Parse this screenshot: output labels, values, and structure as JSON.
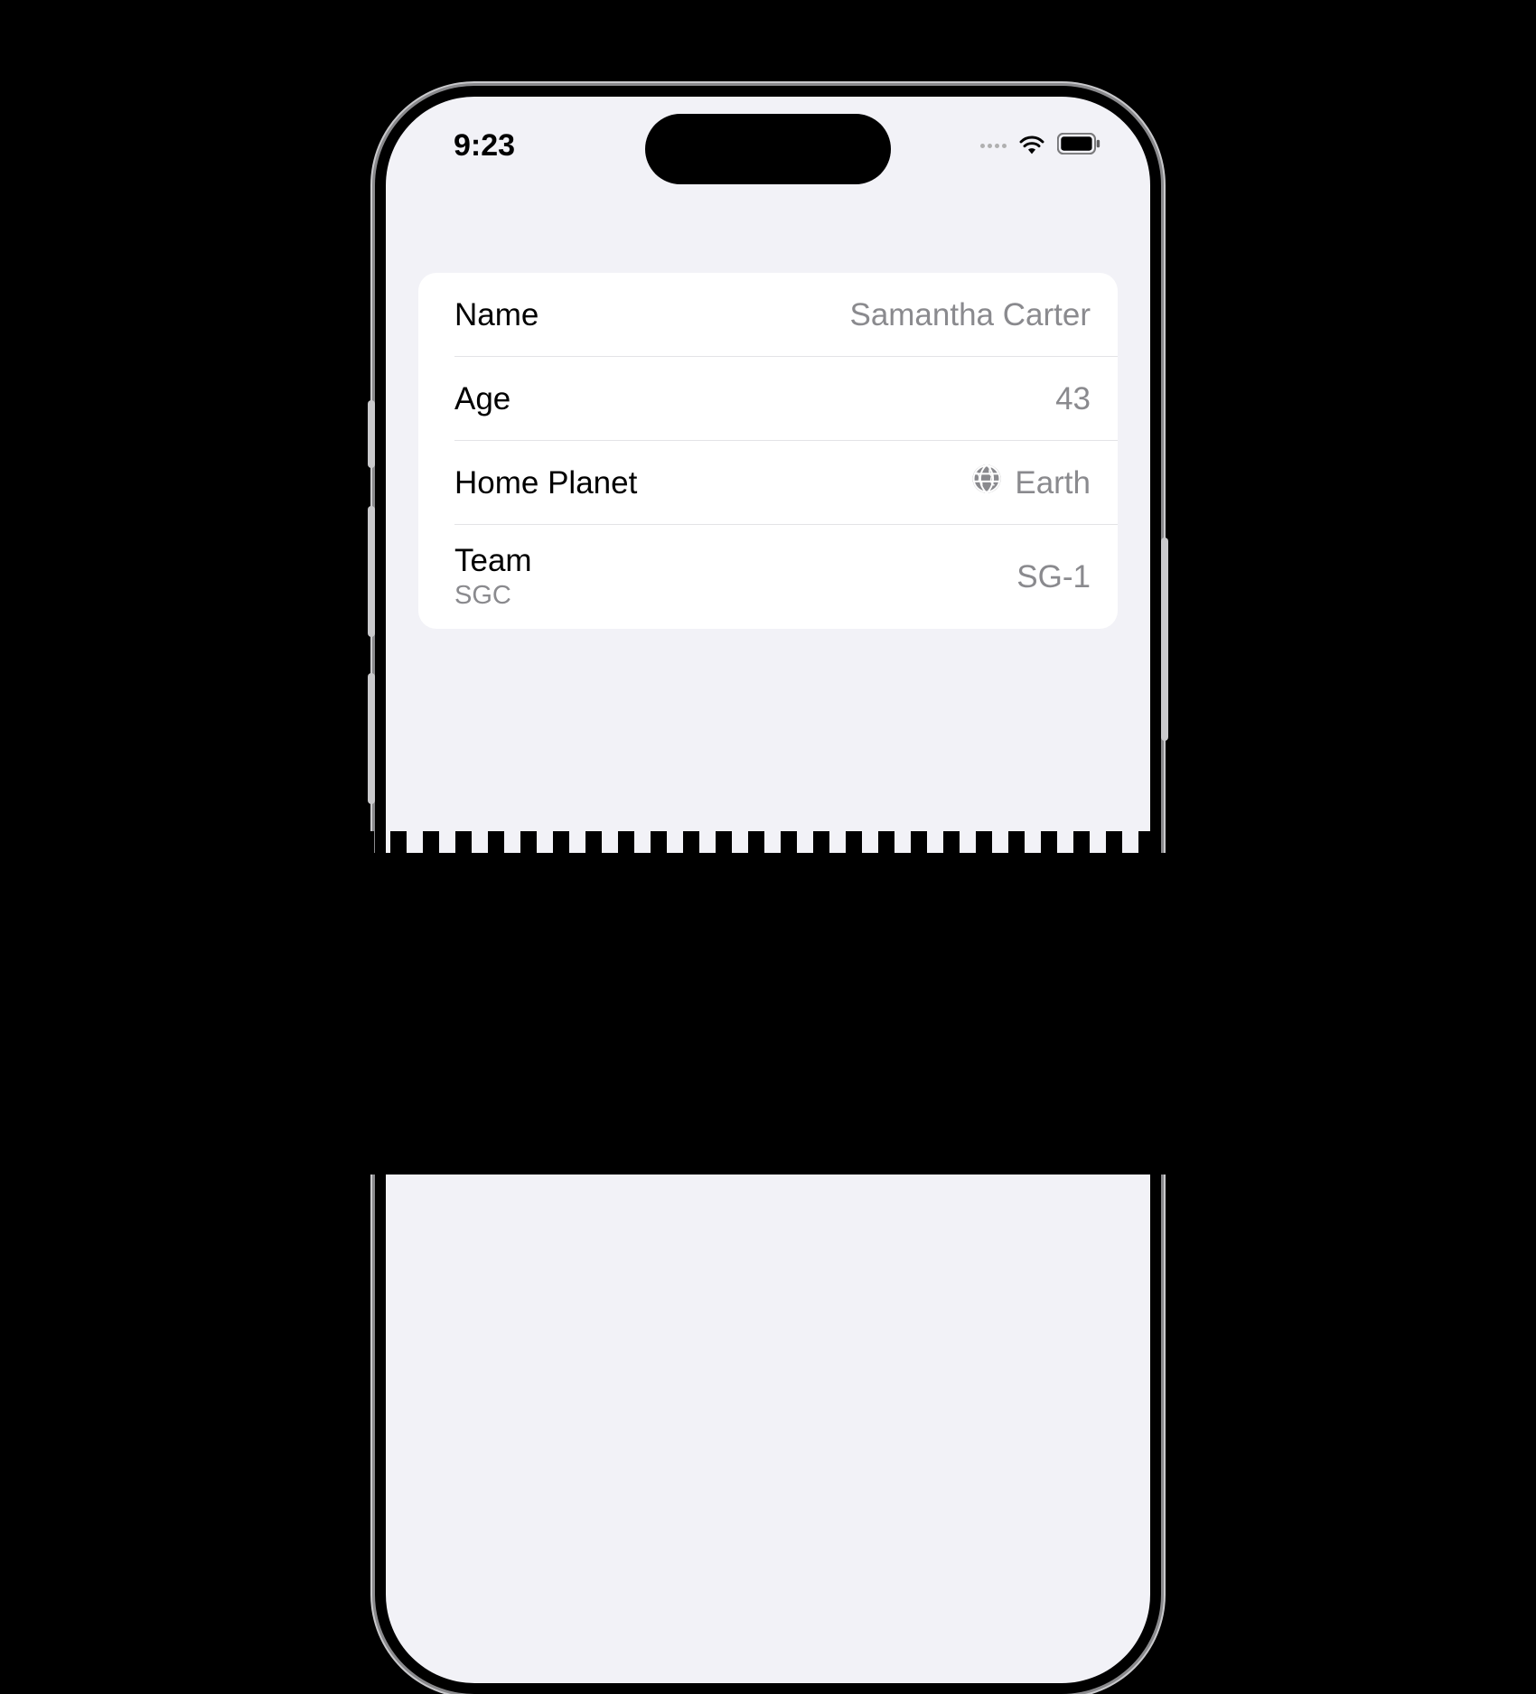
{
  "statusBar": {
    "time": "9:23"
  },
  "rows": [
    {
      "title": "Name",
      "value": "Samantha Carter"
    },
    {
      "title": "Age",
      "value": "43"
    },
    {
      "title": "Home Planet",
      "value": "Earth"
    },
    {
      "title": "Team",
      "subtitle": "SGC",
      "value": "SG-1"
    }
  ]
}
